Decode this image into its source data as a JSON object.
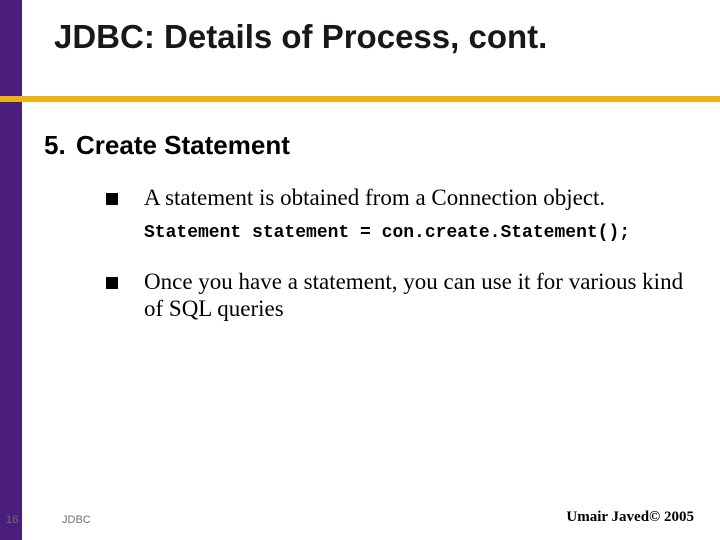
{
  "header": {
    "title": "JDBC: Details of Process, cont."
  },
  "section": {
    "number": "5.",
    "heading": "Create Statement",
    "bullets": [
      "A statement is obtained from a Connection object.",
      "Once you have a statement, you can use it for various kind of SQL queries"
    ],
    "code": "Statement statement = con.create.Statement();"
  },
  "footer": {
    "page": "16",
    "label": "JDBC",
    "copyright": "Umair Javed© 2005"
  }
}
